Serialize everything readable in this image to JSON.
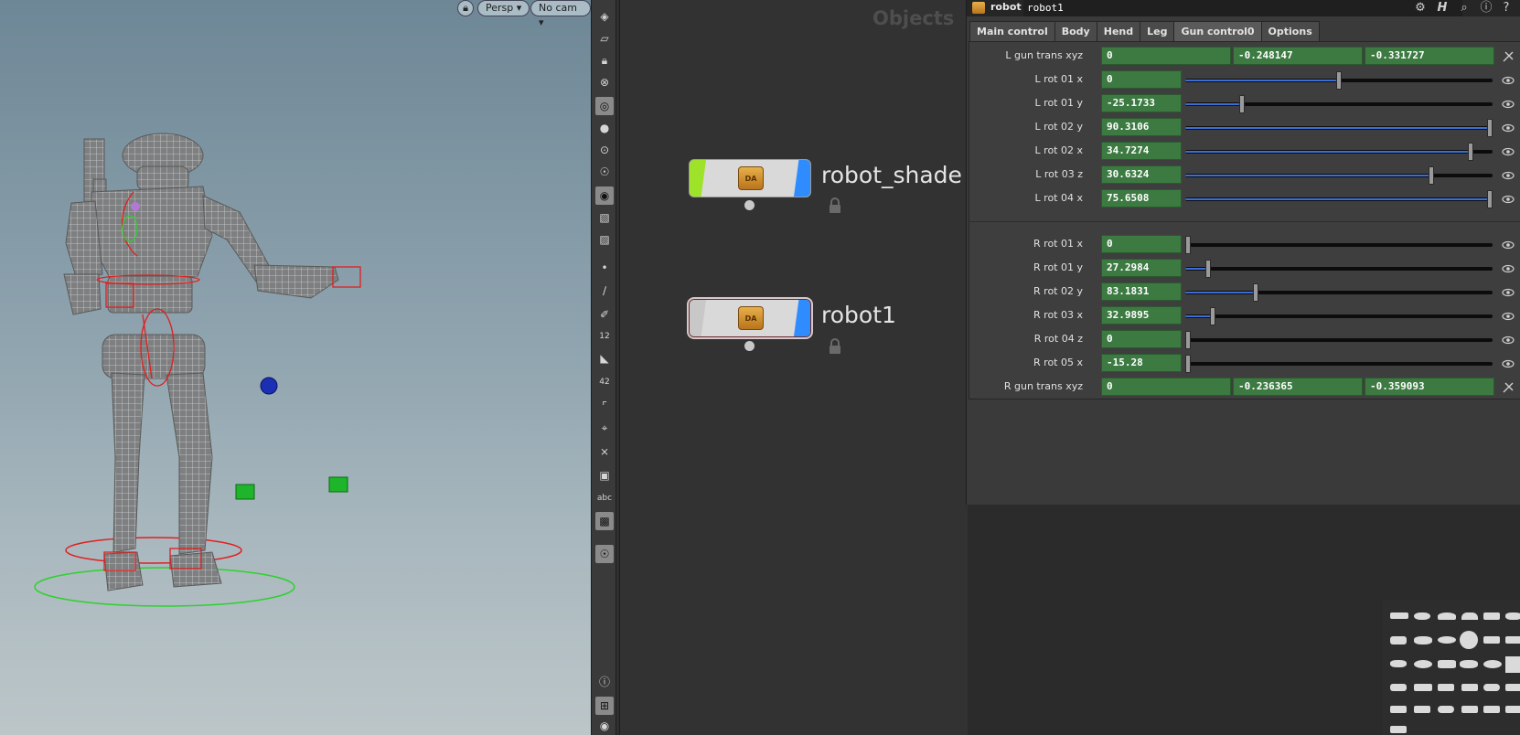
{
  "viewport": {
    "lock_label": "",
    "camera_view": "Persp",
    "camera_select": "No cam"
  },
  "toolshelf": {
    "tools": [
      "view-icon",
      "select-icon",
      "lock-icon",
      "snap-icon",
      "light-icon",
      "bulb-icon",
      "bulb-small-icon",
      "light-gizmo-icon",
      "camera-icon",
      "object-icon",
      "render-icon",
      "point-icon",
      "brush-icon",
      "pen-icon",
      "number-icon",
      "bucket-icon",
      "bucket-count-icon",
      "corner-icon",
      "grid-snap-icon",
      "axis-icon",
      "circle-icon",
      "text-icon",
      "image-icon",
      "pin-icon",
      "info-icon",
      "layout-icon",
      "eye-icon"
    ],
    "number_label": "12",
    "count_label": "42",
    "text_label": "abc"
  },
  "network": {
    "context_label": "Objects",
    "nodes": [
      {
        "name": "robot_shade",
        "icon": "package-icon",
        "box_text": "DA"
      },
      {
        "name": "robot1",
        "icon": "package-icon",
        "box_text": "DA"
      }
    ]
  },
  "params": {
    "node_type": "robot",
    "node_name": "robot1",
    "header_icons": [
      "gear-icon",
      "houdini-help-icon",
      "search-icon",
      "info-icon",
      "help-icon"
    ],
    "tabs": [
      "Main control",
      "Body",
      "Hend",
      "Leg",
      "Gun control0",
      "Options"
    ],
    "active_tab": "Gun control0",
    "rows": [
      {
        "label": "L gun trans xyz",
        "values": [
          "0",
          "-0.248147",
          "-0.331727"
        ]
      },
      {
        "label": "L rot 01 x",
        "value": "0",
        "slider": 0.5
      },
      {
        "label": "L rot 01 y",
        "value": "-25.1733",
        "slider": 0.185
      },
      {
        "label": "L rot 02 y",
        "value": "90.3106",
        "slider": 1.0
      },
      {
        "label": "L rot 02 x",
        "value": "34.7274",
        "slider": 0.93
      },
      {
        "label": "L rot 03 z",
        "value": "30.6324",
        "slider": 0.8
      },
      {
        "label": "L rot 04 x",
        "value": "75.6508",
        "slider": 1.0
      },
      {
        "label": "R rot 01 x",
        "value": "0",
        "slider": 0.0
      },
      {
        "label": "R rot 01 y",
        "value": "27.2984",
        "slider": 0.075
      },
      {
        "label": "R rot 02 y",
        "value": "83.1831",
        "slider": 0.23
      },
      {
        "label": "R rot 03 x",
        "value": "32.9895",
        "slider": 0.09
      },
      {
        "label": "R rot 04 z",
        "value": "0",
        "slider": 0.0
      },
      {
        "label": "R rot 05 x",
        "value": "-15.28",
        "slider": 0.0
      },
      {
        "label": "R gun trans xyz",
        "values": [
          "0",
          "-0.236365",
          "-0.359093"
        ]
      }
    ]
  }
}
